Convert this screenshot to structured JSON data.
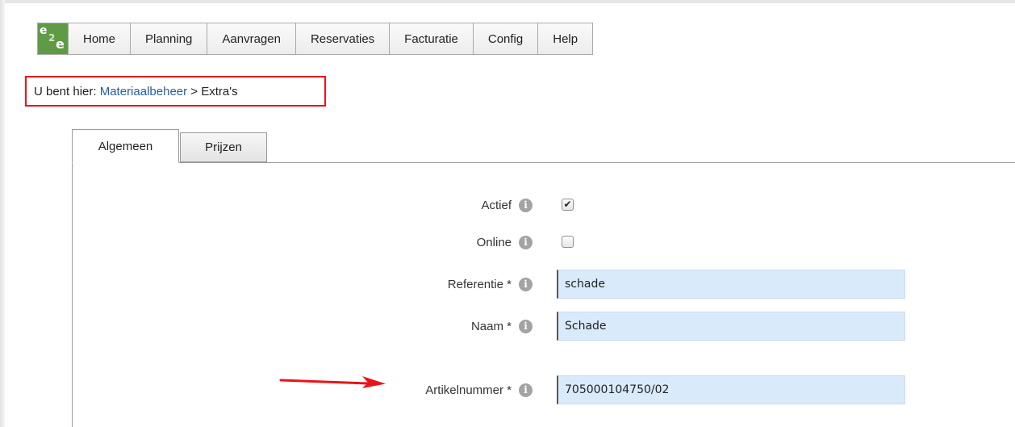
{
  "menubar": {
    "logo": {
      "l1": "e",
      "l2": "2",
      "l3": "e"
    },
    "items": [
      "Home",
      "Planning",
      "Aanvragen",
      "Reservaties",
      "Facturatie",
      "Config",
      "Help"
    ]
  },
  "breadcrumb": {
    "prefix": "U bent hier:",
    "link": "Materiaalbeheer",
    "separator": ">",
    "current": "Extra's"
  },
  "tabs": [
    "Algemeen",
    "Prijzen"
  ],
  "form": {
    "info_glyph": "i",
    "actief": {
      "label": "Actief",
      "checked": true,
      "check_glyph": "✔"
    },
    "online": {
      "label": "Online",
      "checked": false
    },
    "referentie": {
      "label": "Referentie *",
      "value": "schade"
    },
    "naam": {
      "label": "Naam *",
      "value": "Schade"
    },
    "artikelnummer": {
      "label": "Artikelnummer *",
      "value": "705000104750/02"
    }
  },
  "colors": {
    "highlight": "#e8141a",
    "input_bg": "#d9ebfa",
    "link": "#1f5fa5",
    "logo": "#5e9b44"
  }
}
